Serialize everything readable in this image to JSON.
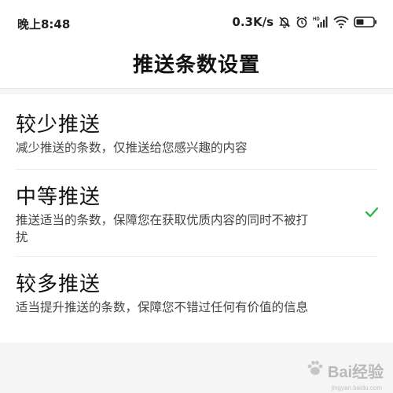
{
  "status_bar": {
    "time": "晚上8:48",
    "speed": "0.3K/s",
    "icons": [
      "mute-bell-icon",
      "alarm-icon",
      "signal-icon",
      "wifi-icon",
      "battery-icon"
    ],
    "signal_hd_label": "HD"
  },
  "header": {
    "title": "推送条数设置"
  },
  "options": [
    {
      "title": "较少推送",
      "description": "减少推送的条数，仅推送给您感兴趣的内容",
      "selected": false
    },
    {
      "title": "中等推送",
      "description": "推送适当的条数，保障您在获取优质内容的同时不被打扰",
      "selected": true
    },
    {
      "title": "较多推送",
      "description": "适当提升推送的条数，保障您不错过任何有价值的信息",
      "selected": false
    }
  ],
  "watermark": {
    "text": "Bai经验",
    "sub": "jingyan.baidu.com"
  },
  "colors": {
    "accent_check": "#2db84d",
    "background": "#f5f5f5"
  }
}
